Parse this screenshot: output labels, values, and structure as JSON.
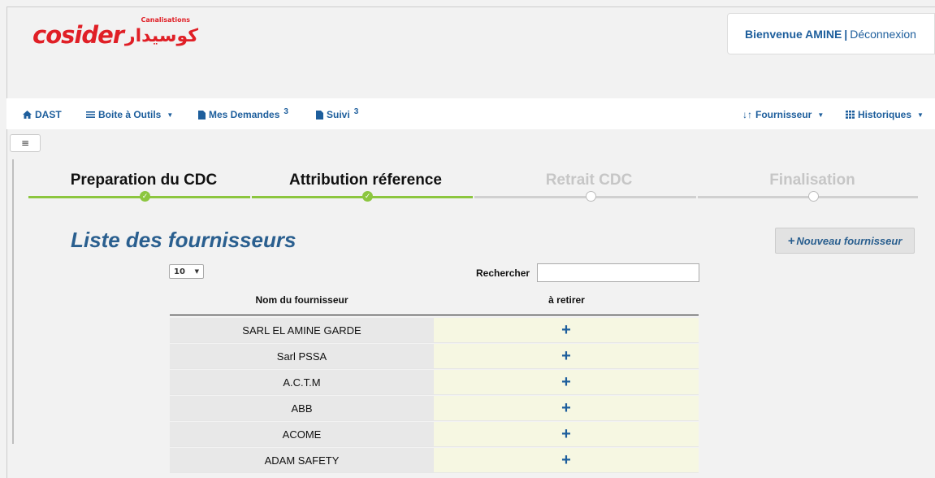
{
  "brand": {
    "logo_latin": "cosider",
    "logo_sub": "Canalisations",
    "logo_arabic": "كوسيدار",
    "color": "#e01f26"
  },
  "user": {
    "welcome": "Bienvenue AMINE",
    "separator": "|",
    "logout": "Déconnexion"
  },
  "nav": {
    "left": [
      {
        "icon": "home-icon",
        "label": "DAST",
        "badge": ""
      },
      {
        "icon": "menu-icon",
        "label": "Boite à Outils",
        "badge": ""
      },
      {
        "icon": "file-icon",
        "label": "Mes Demandes",
        "badge": "3"
      },
      {
        "icon": "file-icon",
        "label": "Suivi",
        "badge": "3"
      }
    ],
    "right": [
      {
        "icon": "sort-icon",
        "label": "Fournisseur"
      },
      {
        "icon": "grid-icon",
        "label": "Historiques"
      }
    ]
  },
  "steps": [
    {
      "label": "Preparation du CDC",
      "status": "done"
    },
    {
      "label": "Attribution réference",
      "status": "done"
    },
    {
      "label": "Retrait CDC",
      "status": "todo"
    },
    {
      "label": "Finalisation",
      "status": "todo"
    }
  ],
  "section": {
    "title": "Liste des fournisseurs",
    "new_button": "Nouveau fournisseur",
    "page_length": "10",
    "search_label": "Rechercher",
    "search_value": ""
  },
  "table": {
    "headers": [
      "Nom du fournisseur",
      "à retirer"
    ],
    "rows": [
      {
        "name": "SARL EL AMINE GARDE",
        "action": "+"
      },
      {
        "name": "Sarl PSSA",
        "action": "+"
      },
      {
        "name": "A.C.T.M",
        "action": "+"
      },
      {
        "name": "ABB",
        "action": "+"
      },
      {
        "name": "ACOME",
        "action": "+"
      },
      {
        "name": "ADAM SAFETY",
        "action": "+"
      }
    ]
  },
  "colors": {
    "accent": "#1d5e9c",
    "step_done": "#8cc63f",
    "step_todo": "#d0d0d0",
    "action_cell": "#f6f7e2"
  }
}
